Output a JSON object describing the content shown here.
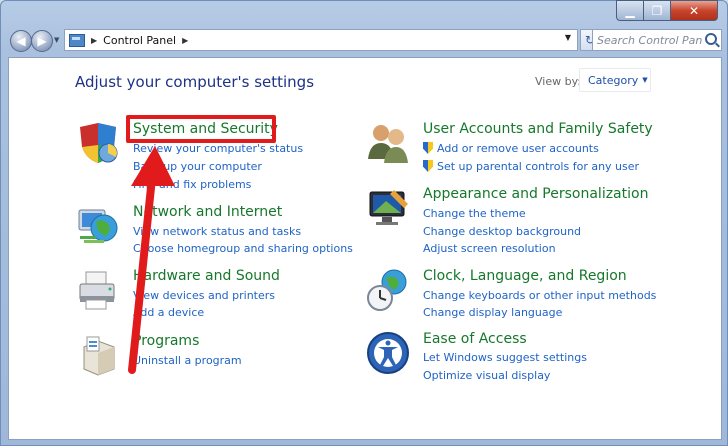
{
  "window": {
    "caption": {
      "minimize": "▁",
      "maximize": "❐",
      "close": "✕"
    }
  },
  "address": {
    "crumb": "Control Panel",
    "search_placeholder": "Search Control Panel"
  },
  "header": {
    "title": "Adjust your computer's settings",
    "view_by_label": "View by:",
    "view_by_value": "Category"
  },
  "categories": [
    {
      "id": "system-security",
      "title": "System and Security",
      "icon": "shield-pie-icon",
      "links": [
        "Review your computer's status",
        "Back up your computer",
        "Find and fix problems"
      ]
    },
    {
      "id": "network-internet",
      "title": "Network and Internet",
      "icon": "globe-network-icon",
      "links": [
        "View network status and tasks",
        "Choose homegroup and sharing options"
      ]
    },
    {
      "id": "hardware-sound",
      "title": "Hardware and Sound",
      "icon": "printer-icon",
      "links": [
        "View devices and printers",
        "Add a device"
      ]
    },
    {
      "id": "programs",
      "title": "Programs",
      "icon": "programs-box-icon",
      "links": [
        "Uninstall a program"
      ]
    },
    {
      "id": "user-accounts",
      "title": "User Accounts and Family Safety",
      "icon": "users-icon",
      "links": [
        "Add or remove user accounts",
        "Set up parental controls for any user"
      ]
    },
    {
      "id": "appearance",
      "title": "Appearance and Personalization",
      "icon": "monitor-icon",
      "links": [
        "Change the theme",
        "Change desktop background",
        "Adjust screen resolution"
      ]
    },
    {
      "id": "clock-region",
      "title": "Clock, Language, and Region",
      "icon": "clock-globe-icon",
      "links": [
        "Change keyboards or other input methods",
        "Change display language"
      ]
    },
    {
      "id": "ease-access",
      "title": "Ease of Access",
      "icon": "ease-of-access-icon",
      "links": [
        "Let Windows suggest settings",
        "Optimize visual display"
      ]
    }
  ],
  "annotation": {
    "highlight_color": "#e11b1b"
  }
}
